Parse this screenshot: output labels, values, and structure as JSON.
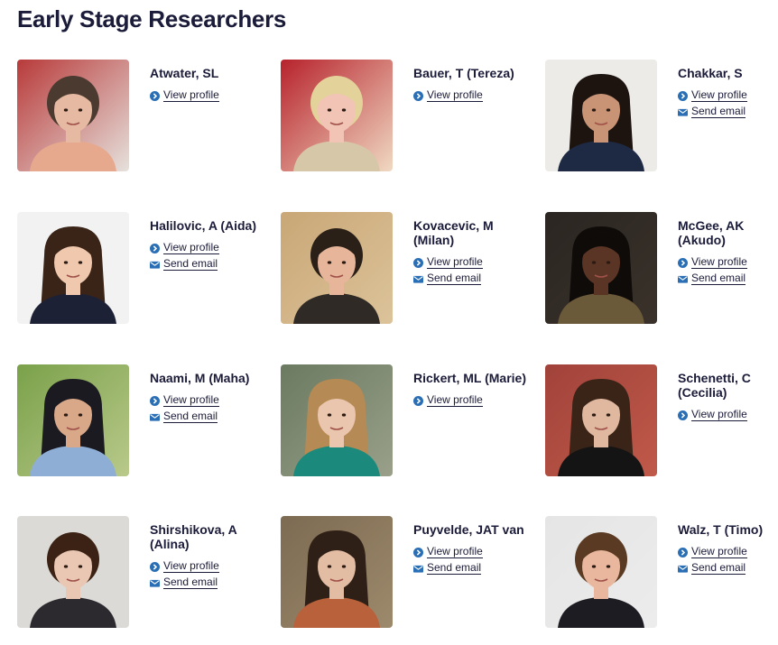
{
  "page": {
    "title": "Early Stage Researchers"
  },
  "researchers": [
    {
      "name": "Atwater, SL",
      "links": [
        "View profile"
      ]
    },
    {
      "name": "Bauer, T (Tereza)",
      "links": [
        "View profile"
      ]
    },
    {
      "name": "Chakkar, S",
      "links": [
        "View profile",
        "Send email"
      ]
    },
    {
      "name": "Halilovic, A (Aida)",
      "links": [
        "View profile",
        "Send email"
      ]
    },
    {
      "name": "Kovacevic, M (Milan)",
      "links": [
        "View profile",
        "Send email"
      ]
    },
    {
      "name": "McGee, AK (Akudo)",
      "links": [
        "View profile",
        "Send email"
      ]
    },
    {
      "name": "Naami, M (Maha)",
      "links": [
        "View profile",
        "Send email"
      ]
    },
    {
      "name": "Rickert, ML (Marie)",
      "links": [
        "View profile"
      ]
    },
    {
      "name": "Schenetti, C (Cecilia)",
      "links": [
        "View profile"
      ]
    },
    {
      "name": "Shirshikova, A (Alina)",
      "links": [
        "View profile",
        "Send email"
      ]
    },
    {
      "name": "Puyvelde, JAT van",
      "links": [
        "View profile",
        "Send email"
      ]
    },
    {
      "name": "Walz, T (Timo)",
      "links": [
        "View profile",
        "Send email"
      ]
    }
  ],
  "colors": {
    "title": "#1b1b3a",
    "icon": "#2a6fb5"
  },
  "icons": {
    "profile": "chevron-right-circle-icon",
    "email": "envelope-icon"
  }
}
